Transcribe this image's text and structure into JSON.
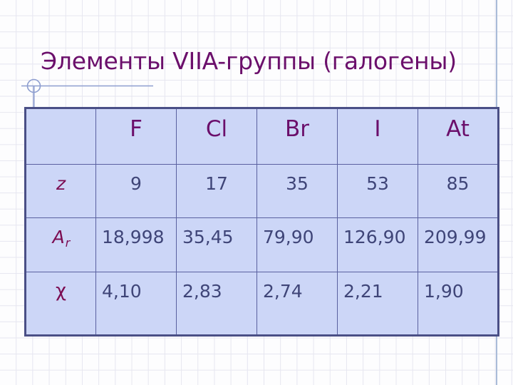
{
  "slide": {
    "title": "Элементы VIIA-группы (галогены)",
    "accent_color": "#6b0f6b",
    "label_color": "#7c0d52",
    "value_color": "#3f4578",
    "cell_fill": "#ccd6f7",
    "cell_border": "#5a61a0",
    "table_border": "#4a4f86",
    "grid_line_color": "#e6e6f0",
    "margin_rule_color": "#aabcd8",
    "background_color": "#fdfdfe"
  },
  "ornament": {
    "name": "compass-pin-ornament",
    "stroke_color": "#8e9ed0"
  },
  "table": {
    "corner_label": "",
    "columns": [
      "F",
      "Cl",
      "Br",
      "I",
      "At"
    ],
    "rows": [
      {
        "label": "z",
        "label_sub": "",
        "values": [
          "9",
          "17",
          "35",
          "53",
          "85"
        ],
        "align": "center"
      },
      {
        "label": "A",
        "label_sub": "r",
        "values": [
          "18,998",
          "35,45",
          "79,90",
          "126,90",
          "209,99"
        ],
        "align": "left"
      },
      {
        "label": "χ",
        "label_sub": "",
        "values": [
          "4,10",
          "2,83",
          "2,74",
          "2,21",
          "1,90"
        ],
        "align": "left"
      }
    ]
  }
}
